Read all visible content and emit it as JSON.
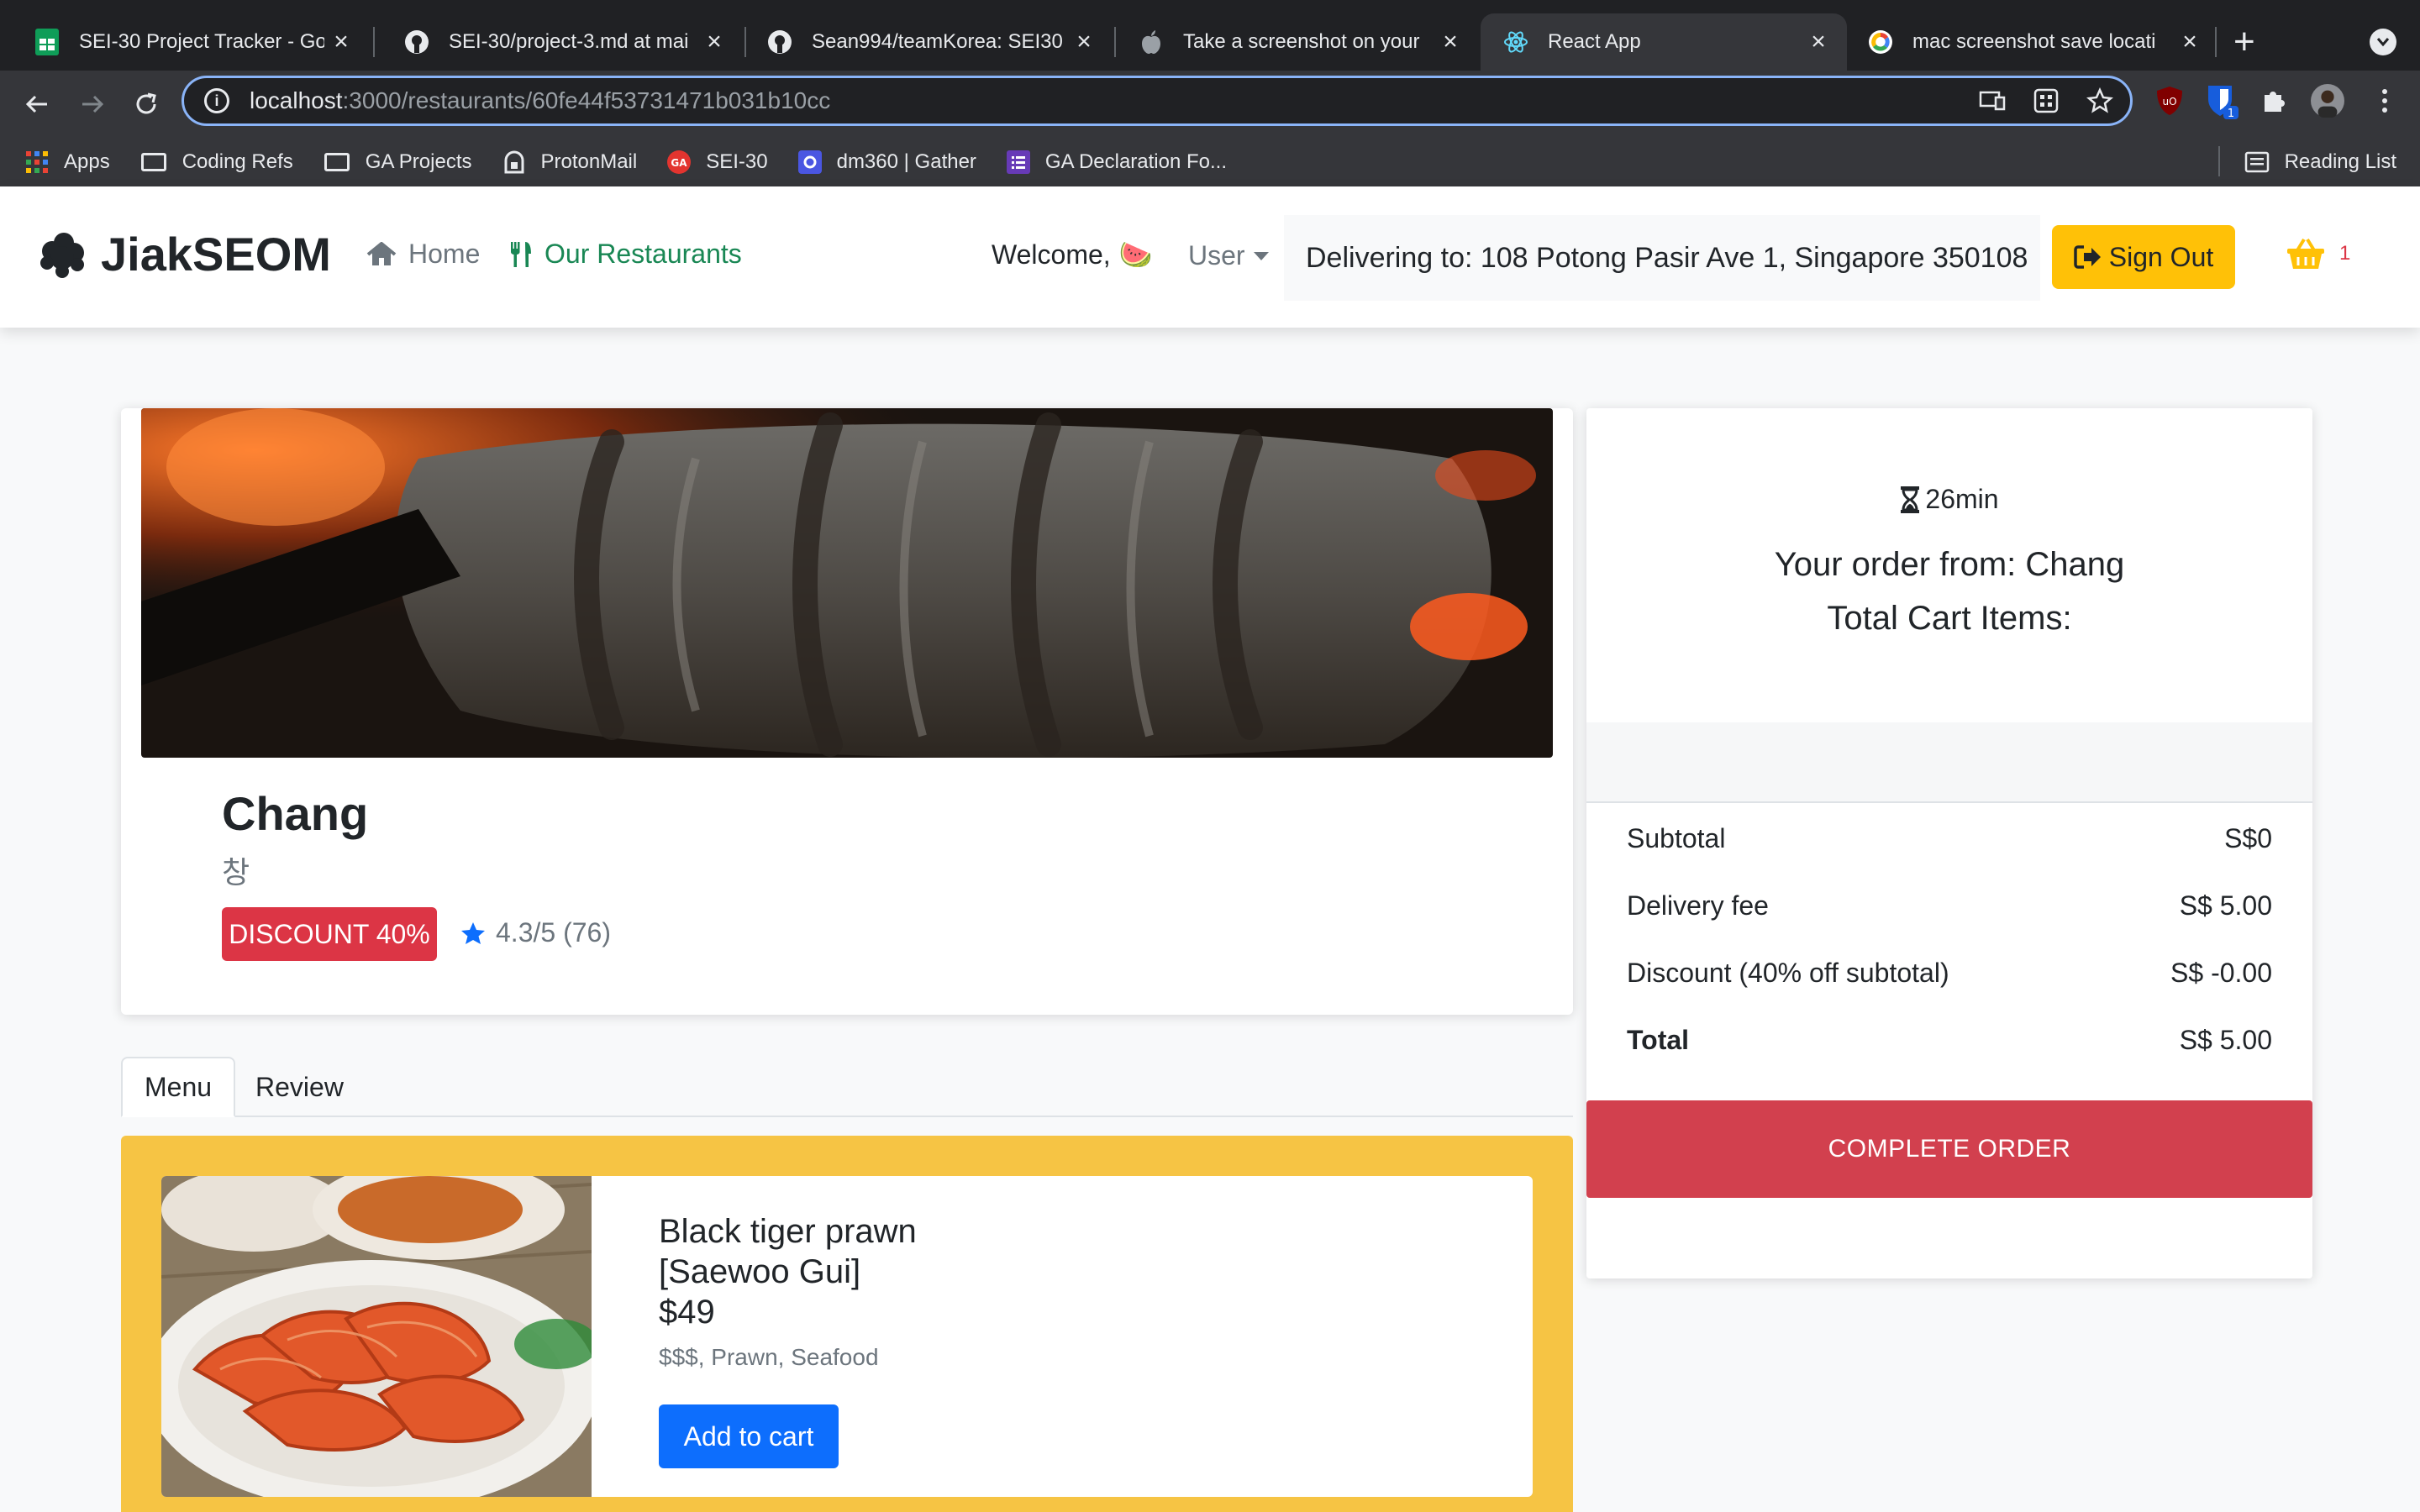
{
  "browser": {
    "tabs": [
      {
        "title": "SEI-30 Project Tracker - Go",
        "icon": "google-sheets-icon"
      },
      {
        "title": "SEI-30/project-3.md at mai",
        "icon": "github-icon"
      },
      {
        "title": "Sean994/teamKorea: SEI30",
        "icon": "github-icon"
      },
      {
        "title": "Take a screenshot on your",
        "icon": "apple-icon"
      },
      {
        "title": "React App",
        "icon": "react-icon",
        "active": true
      },
      {
        "title": "mac screenshot save locati",
        "icon": "google-icon"
      }
    ],
    "url": {
      "host": "localhost",
      "rest": ":3000/restaurants/60fe44f53731471b031b10cc"
    },
    "bookmarks": [
      "Apps",
      "Coding Refs",
      "GA Projects",
      "ProtonMail",
      "SEI-30",
      "dm360 | Gather",
      "GA Declaration Fo..."
    ],
    "reading_list": "Reading List",
    "extension_badge": "1"
  },
  "header": {
    "brand": "JiakSEOM",
    "nav": {
      "home": "Home",
      "restaurants": "Our Restaurants"
    },
    "welcome": "Welcome,",
    "welcome_emoji": "🍉",
    "user": "User",
    "delivering": "Delivering to: 108 Potong Pasir Ave 1, Singapore 350108",
    "sign_out": "Sign Out",
    "cart_count": "1"
  },
  "restaurant": {
    "name": "Chang",
    "korean_name": "창",
    "discount": "DISCOUNT 40%",
    "rating": "4.3/5 (76)"
  },
  "tabs": {
    "menu": "Menu",
    "review": "Review"
  },
  "menu": [
    {
      "name_line1": "Black tiger prawn",
      "name_line2": "[Saewoo Gui]",
      "price": "$49",
      "tags": "$$$, Prawn, Seafood",
      "button": "Add to cart"
    }
  ],
  "order": {
    "eta": "26min",
    "from": "Your order from: Chang",
    "items": "Total Cart Items:",
    "subtotal": {
      "label": "Subtotal",
      "value": "S$0"
    },
    "delivery": {
      "label": "Delivery fee",
      "value": "S$ 5.00"
    },
    "discount": {
      "label": "Discount (40% off subtotal)",
      "value": "S$ -0.00"
    },
    "total": {
      "label": "Total",
      "value": "S$ 5.00"
    },
    "complete": "COMPLETE ORDER"
  },
  "colors": {
    "accent_yellow": "#ffc107",
    "danger_red": "#dc3545",
    "primary_blue": "#0d6efd",
    "success_green": "#198754"
  }
}
